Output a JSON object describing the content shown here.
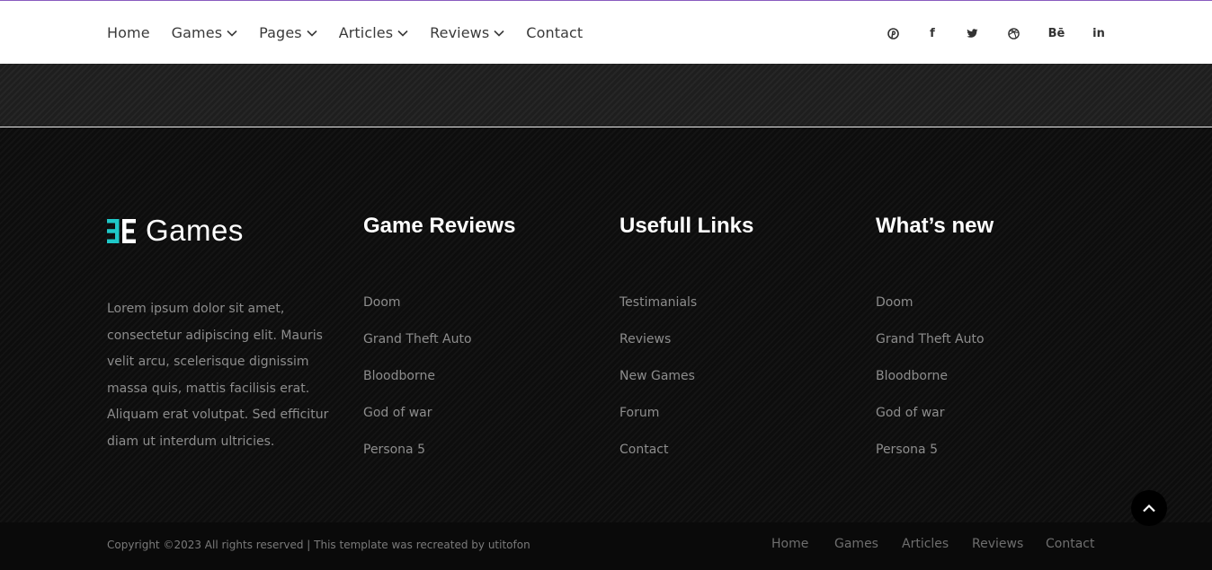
{
  "colors": {
    "accent": "#1fc8c8",
    "nav_border": "#8a5cc0",
    "footer_bg": "#101010"
  },
  "nav": {
    "items": [
      {
        "label": "Home",
        "dropdown": false
      },
      {
        "label": "Games",
        "dropdown": true
      },
      {
        "label": "Pages",
        "dropdown": true
      },
      {
        "label": "Articles",
        "dropdown": true
      },
      {
        "label": "Reviews",
        "dropdown": true
      },
      {
        "label": "Contact",
        "dropdown": false
      }
    ]
  },
  "social": {
    "icons": [
      "pinterest-icon",
      "facebook-icon",
      "twitter-icon",
      "dribbble-icon",
      "behance-icon",
      "linkedin-icon"
    ],
    "behance_text": "Bē",
    "linkedin_text": "in",
    "facebook_text": "f"
  },
  "footer": {
    "logo_text": "Games",
    "about": "Lorem ipsum dolor sit amet, consectetur adipiscing elit. Mauris velit arcu, scelerisque dignissim massa quis, mattis facilisis erat. Aliquam erat volutpat. Sed efficitur diam ut interdum ultricies.",
    "columns": [
      {
        "title": "Game Reviews",
        "links": [
          "Doom",
          "Grand Theft Auto",
          "Bloodborne",
          "God of war",
          "Persona 5"
        ]
      },
      {
        "title": "Usefull Links",
        "links": [
          "Testimanials",
          "Reviews",
          "New Games",
          "Forum",
          "Contact"
        ]
      },
      {
        "title": "What’s new",
        "links": [
          "Doom",
          "Grand Theft Auto",
          "Bloodborne",
          "God of war",
          "Persona 5"
        ]
      }
    ]
  },
  "bottom": {
    "copyright": "Copyright ©2023 All rights reserved | This template was recreated by utitofon",
    "links": [
      "Home",
      "Games",
      "Articles",
      "Reviews",
      "Contact"
    ]
  }
}
